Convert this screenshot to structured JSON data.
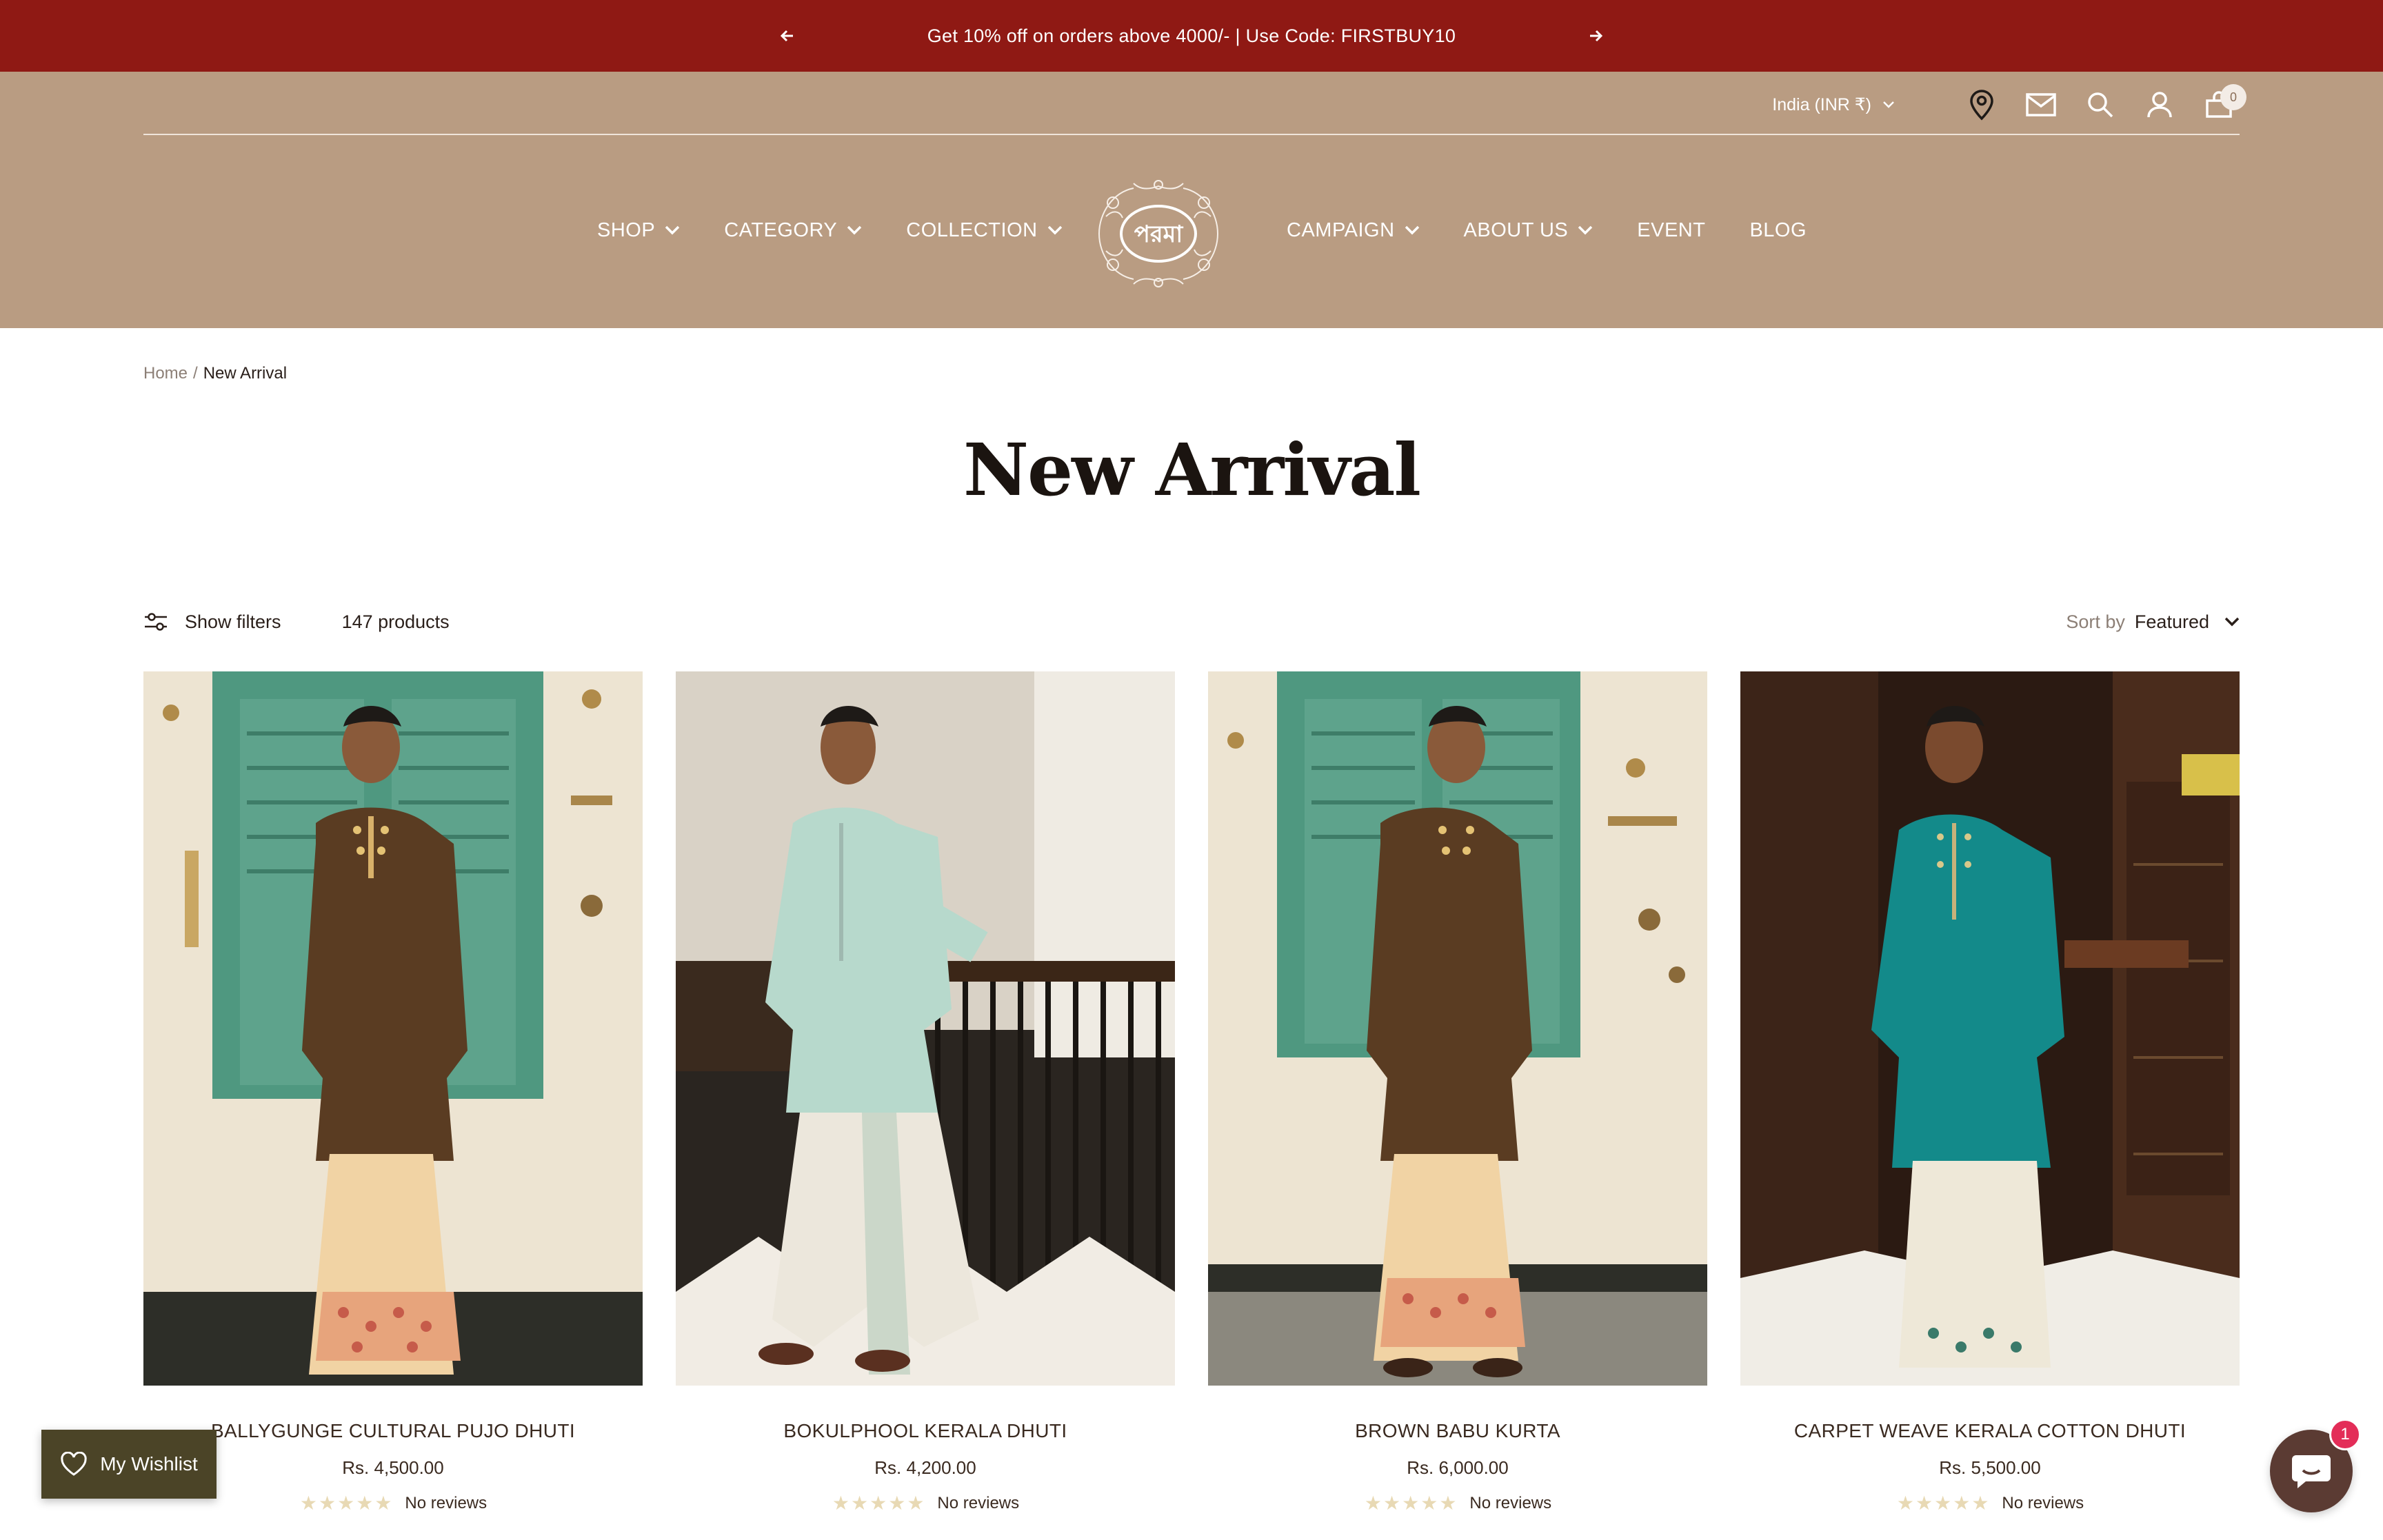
{
  "announcement": {
    "message": "Get 10% off on orders above 4000/- | Use Code: FIRSTBUY10"
  },
  "header": {
    "country": "India (INR ₹)",
    "cart_count": "0",
    "nav_left": [
      {
        "label": "SHOP",
        "dropdown": true
      },
      {
        "label": "CATEGORY",
        "dropdown": true
      },
      {
        "label": "COLLECTION",
        "dropdown": true
      }
    ],
    "nav_right": [
      {
        "label": "CAMPAIGN",
        "dropdown": true
      },
      {
        "label": "ABOUT US",
        "dropdown": true
      },
      {
        "label": "EVENT",
        "dropdown": false
      },
      {
        "label": "BLOG",
        "dropdown": false
      }
    ],
    "logo_text": "পরমা"
  },
  "breadcrumb": {
    "home": "Home",
    "separator": "/",
    "current": "New Arrival"
  },
  "page_title": "New Arrival",
  "toolbar": {
    "filters_label": "Show filters",
    "product_count": "147 products",
    "sort_label": "Sort by",
    "sort_value": "Featured"
  },
  "products": [
    {
      "name": "BALLYGUNGE CULTURAL PUJO DHUTI",
      "price": "Rs. 4,500.00",
      "reviews": "No reviews",
      "rating": 0
    },
    {
      "name": "BOKULPHOOL KERALA DHUTI",
      "price": "Rs. 4,200.00",
      "reviews": "No reviews",
      "rating": 0
    },
    {
      "name": "BROWN BABU KURTA",
      "price": "Rs. 6,000.00",
      "reviews": "No reviews",
      "rating": 0
    },
    {
      "name": "CARPET WEAVE KERALA COTTON DHUTI",
      "price": "Rs. 5,500.00",
      "reviews": "No reviews",
      "rating": 0
    }
  ],
  "wishlist": {
    "label": "My Wishlist"
  },
  "chat": {
    "badge": "1"
  },
  "colors": {
    "announcement_bg": "#8f1914",
    "header_bg": "#b99c82",
    "wishlist_bg": "#4b4427",
    "chat_bg": "#5b3b33",
    "badge": "#e32d58"
  }
}
